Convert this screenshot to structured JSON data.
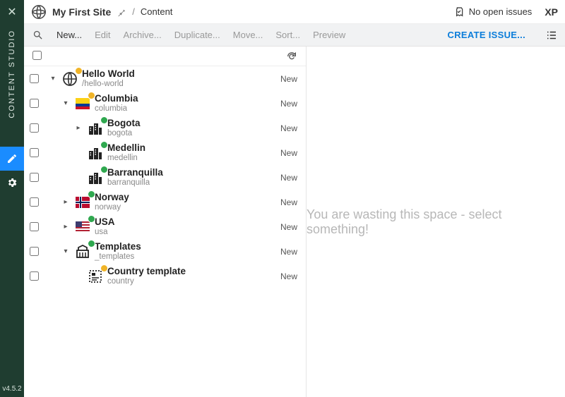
{
  "leftbar": {
    "label": "CONTENT STUDIO",
    "version": "v4.5.2"
  },
  "header": {
    "siteName": "My First Site",
    "breadcrumb": "Content",
    "issuesLabel": "No open issues",
    "brand": "XP"
  },
  "toolbar": {
    "new": "New...",
    "edit": "Edit",
    "archive": "Archive...",
    "duplicate": "Duplicate...",
    "move": "Move...",
    "sort": "Sort...",
    "preview": "Preview",
    "createIssue": "CREATE ISSUE..."
  },
  "preview": {
    "empty": "You are wasting this space - select something!"
  },
  "tree": {
    "items": [
      {
        "name": "Hello World",
        "path": "/hello-world",
        "status": "New",
        "expand": "expanded",
        "indent": 0,
        "icon": "globe",
        "badge": "warn"
      },
      {
        "name": "Columbia",
        "path": "columbia",
        "status": "New",
        "expand": "expanded",
        "indent": 1,
        "icon": "flag-colombia",
        "badge": "warn"
      },
      {
        "name": "Bogota",
        "path": "bogota",
        "status": "New",
        "expand": "collapsed",
        "indent": 2,
        "icon": "city",
        "badge": "ok"
      },
      {
        "name": "Medellin",
        "path": "medellin",
        "status": "New",
        "expand": "none",
        "indent": 2,
        "icon": "city",
        "badge": "ok"
      },
      {
        "name": "Barranquilla",
        "path": "barranquilla",
        "status": "New",
        "expand": "none",
        "indent": 2,
        "icon": "city",
        "badge": "ok"
      },
      {
        "name": "Norway",
        "path": "norway",
        "status": "New",
        "expand": "collapsed",
        "indent": 1,
        "icon": "flag-norway",
        "badge": "ok"
      },
      {
        "name": "USA",
        "path": "usa",
        "status": "New",
        "expand": "collapsed",
        "indent": 1,
        "icon": "flag-usa",
        "badge": "ok"
      },
      {
        "name": "Templates",
        "path": "_templates",
        "status": "New",
        "expand": "expanded",
        "indent": 1,
        "icon": "templates",
        "badge": "ok"
      },
      {
        "name": "Country template",
        "path": "country",
        "status": "New",
        "expand": "none",
        "indent": 2,
        "icon": "page-template",
        "badge": "warn"
      }
    ]
  }
}
